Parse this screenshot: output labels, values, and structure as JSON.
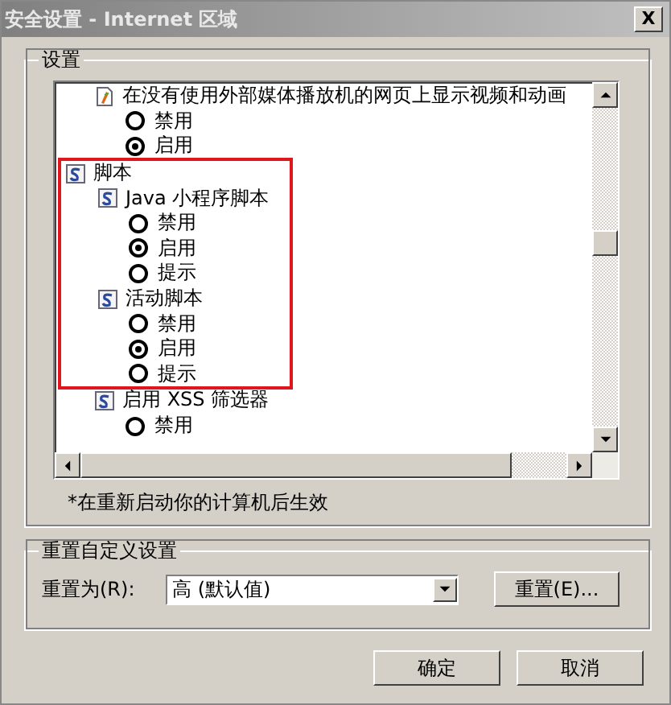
{
  "window": {
    "title": "安全设置 - Internet 区域",
    "close": "X"
  },
  "settings": {
    "label": "设置",
    "tree": [
      {
        "children": [
          {
            "kind": "media",
            "label": "在没有使用外部媒体播放机的网页上显示视频和动画",
            "children": [
              {
                "kind": "option",
                "label": "禁用",
                "selected": false
              },
              {
                "kind": "option",
                "label": "启用",
                "selected": true
              }
            ]
          }
        ]
      },
      {
        "kind": "script",
        "label": "脚本",
        "highlighted": true,
        "children": [
          {
            "kind": "script",
            "label": "Java 小程序脚本",
            "children": [
              {
                "kind": "option",
                "label": "禁用",
                "selected": false
              },
              {
                "kind": "option",
                "label": "启用",
                "selected": true
              },
              {
                "kind": "option",
                "label": "提示",
                "selected": false
              }
            ]
          },
          {
            "kind": "script",
            "label": "活动脚本",
            "children": [
              {
                "kind": "option",
                "label": "禁用",
                "selected": false
              },
              {
                "kind": "option",
                "label": "启用",
                "selected": true
              },
              {
                "kind": "option",
                "label": "提示",
                "selected": false
              }
            ]
          }
        ]
      },
      {
        "children": [
          {
            "kind": "script",
            "label": "启用 XSS 筛选器",
            "children": [
              {
                "kind": "option",
                "label": "禁用",
                "selected": false
              }
            ]
          }
        ]
      }
    ],
    "note": "*在重新启动你的计算机后生效"
  },
  "reset": {
    "label": "重置自定义设置",
    "field_label": "重置为(R):",
    "value": "高 (默认值)",
    "button": "重置(E)..."
  },
  "buttons": [
    "确定",
    "取消"
  ]
}
